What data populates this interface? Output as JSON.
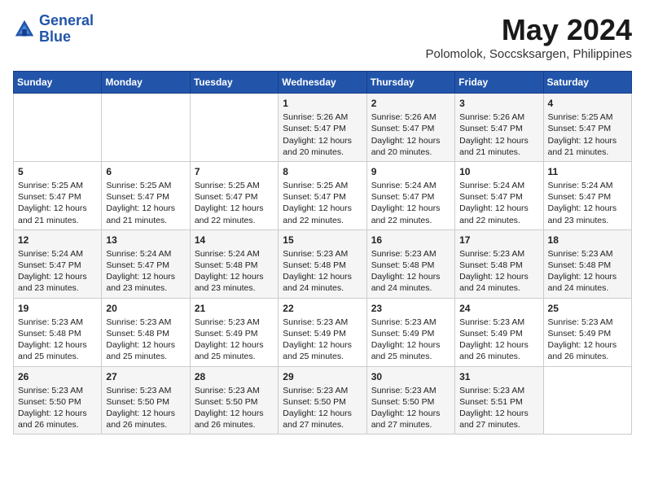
{
  "header": {
    "logo_line1": "General",
    "logo_line2": "Blue",
    "month_year": "May 2024",
    "location": "Polomolok, Soccsksargen, Philippines"
  },
  "days_of_week": [
    "Sunday",
    "Monday",
    "Tuesday",
    "Wednesday",
    "Thursday",
    "Friday",
    "Saturday"
  ],
  "weeks": [
    [
      {
        "day": "",
        "info": ""
      },
      {
        "day": "",
        "info": ""
      },
      {
        "day": "",
        "info": ""
      },
      {
        "day": "1",
        "info": "Sunrise: 5:26 AM\nSunset: 5:47 PM\nDaylight: 12 hours and 20 minutes."
      },
      {
        "day": "2",
        "info": "Sunrise: 5:26 AM\nSunset: 5:47 PM\nDaylight: 12 hours and 20 minutes."
      },
      {
        "day": "3",
        "info": "Sunrise: 5:26 AM\nSunset: 5:47 PM\nDaylight: 12 hours and 21 minutes."
      },
      {
        "day": "4",
        "info": "Sunrise: 5:25 AM\nSunset: 5:47 PM\nDaylight: 12 hours and 21 minutes."
      }
    ],
    [
      {
        "day": "5",
        "info": "Sunrise: 5:25 AM\nSunset: 5:47 PM\nDaylight: 12 hours and 21 minutes."
      },
      {
        "day": "6",
        "info": "Sunrise: 5:25 AM\nSunset: 5:47 PM\nDaylight: 12 hours and 21 minutes."
      },
      {
        "day": "7",
        "info": "Sunrise: 5:25 AM\nSunset: 5:47 PM\nDaylight: 12 hours and 22 minutes."
      },
      {
        "day": "8",
        "info": "Sunrise: 5:25 AM\nSunset: 5:47 PM\nDaylight: 12 hours and 22 minutes."
      },
      {
        "day": "9",
        "info": "Sunrise: 5:24 AM\nSunset: 5:47 PM\nDaylight: 12 hours and 22 minutes."
      },
      {
        "day": "10",
        "info": "Sunrise: 5:24 AM\nSunset: 5:47 PM\nDaylight: 12 hours and 22 minutes."
      },
      {
        "day": "11",
        "info": "Sunrise: 5:24 AM\nSunset: 5:47 PM\nDaylight: 12 hours and 23 minutes."
      }
    ],
    [
      {
        "day": "12",
        "info": "Sunrise: 5:24 AM\nSunset: 5:47 PM\nDaylight: 12 hours and 23 minutes."
      },
      {
        "day": "13",
        "info": "Sunrise: 5:24 AM\nSunset: 5:47 PM\nDaylight: 12 hours and 23 minutes."
      },
      {
        "day": "14",
        "info": "Sunrise: 5:24 AM\nSunset: 5:48 PM\nDaylight: 12 hours and 23 minutes."
      },
      {
        "day": "15",
        "info": "Sunrise: 5:23 AM\nSunset: 5:48 PM\nDaylight: 12 hours and 24 minutes."
      },
      {
        "day": "16",
        "info": "Sunrise: 5:23 AM\nSunset: 5:48 PM\nDaylight: 12 hours and 24 minutes."
      },
      {
        "day": "17",
        "info": "Sunrise: 5:23 AM\nSunset: 5:48 PM\nDaylight: 12 hours and 24 minutes."
      },
      {
        "day": "18",
        "info": "Sunrise: 5:23 AM\nSunset: 5:48 PM\nDaylight: 12 hours and 24 minutes."
      }
    ],
    [
      {
        "day": "19",
        "info": "Sunrise: 5:23 AM\nSunset: 5:48 PM\nDaylight: 12 hours and 25 minutes."
      },
      {
        "day": "20",
        "info": "Sunrise: 5:23 AM\nSunset: 5:48 PM\nDaylight: 12 hours and 25 minutes."
      },
      {
        "day": "21",
        "info": "Sunrise: 5:23 AM\nSunset: 5:49 PM\nDaylight: 12 hours and 25 minutes."
      },
      {
        "day": "22",
        "info": "Sunrise: 5:23 AM\nSunset: 5:49 PM\nDaylight: 12 hours and 25 minutes."
      },
      {
        "day": "23",
        "info": "Sunrise: 5:23 AM\nSunset: 5:49 PM\nDaylight: 12 hours and 25 minutes."
      },
      {
        "day": "24",
        "info": "Sunrise: 5:23 AM\nSunset: 5:49 PM\nDaylight: 12 hours and 26 minutes."
      },
      {
        "day": "25",
        "info": "Sunrise: 5:23 AM\nSunset: 5:49 PM\nDaylight: 12 hours and 26 minutes."
      }
    ],
    [
      {
        "day": "26",
        "info": "Sunrise: 5:23 AM\nSunset: 5:50 PM\nDaylight: 12 hours and 26 minutes."
      },
      {
        "day": "27",
        "info": "Sunrise: 5:23 AM\nSunset: 5:50 PM\nDaylight: 12 hours and 26 minutes."
      },
      {
        "day": "28",
        "info": "Sunrise: 5:23 AM\nSunset: 5:50 PM\nDaylight: 12 hours and 26 minutes."
      },
      {
        "day": "29",
        "info": "Sunrise: 5:23 AM\nSunset: 5:50 PM\nDaylight: 12 hours and 27 minutes."
      },
      {
        "day": "30",
        "info": "Sunrise: 5:23 AM\nSunset: 5:50 PM\nDaylight: 12 hours and 27 minutes."
      },
      {
        "day": "31",
        "info": "Sunrise: 5:23 AM\nSunset: 5:51 PM\nDaylight: 12 hours and 27 minutes."
      },
      {
        "day": "",
        "info": ""
      }
    ]
  ]
}
